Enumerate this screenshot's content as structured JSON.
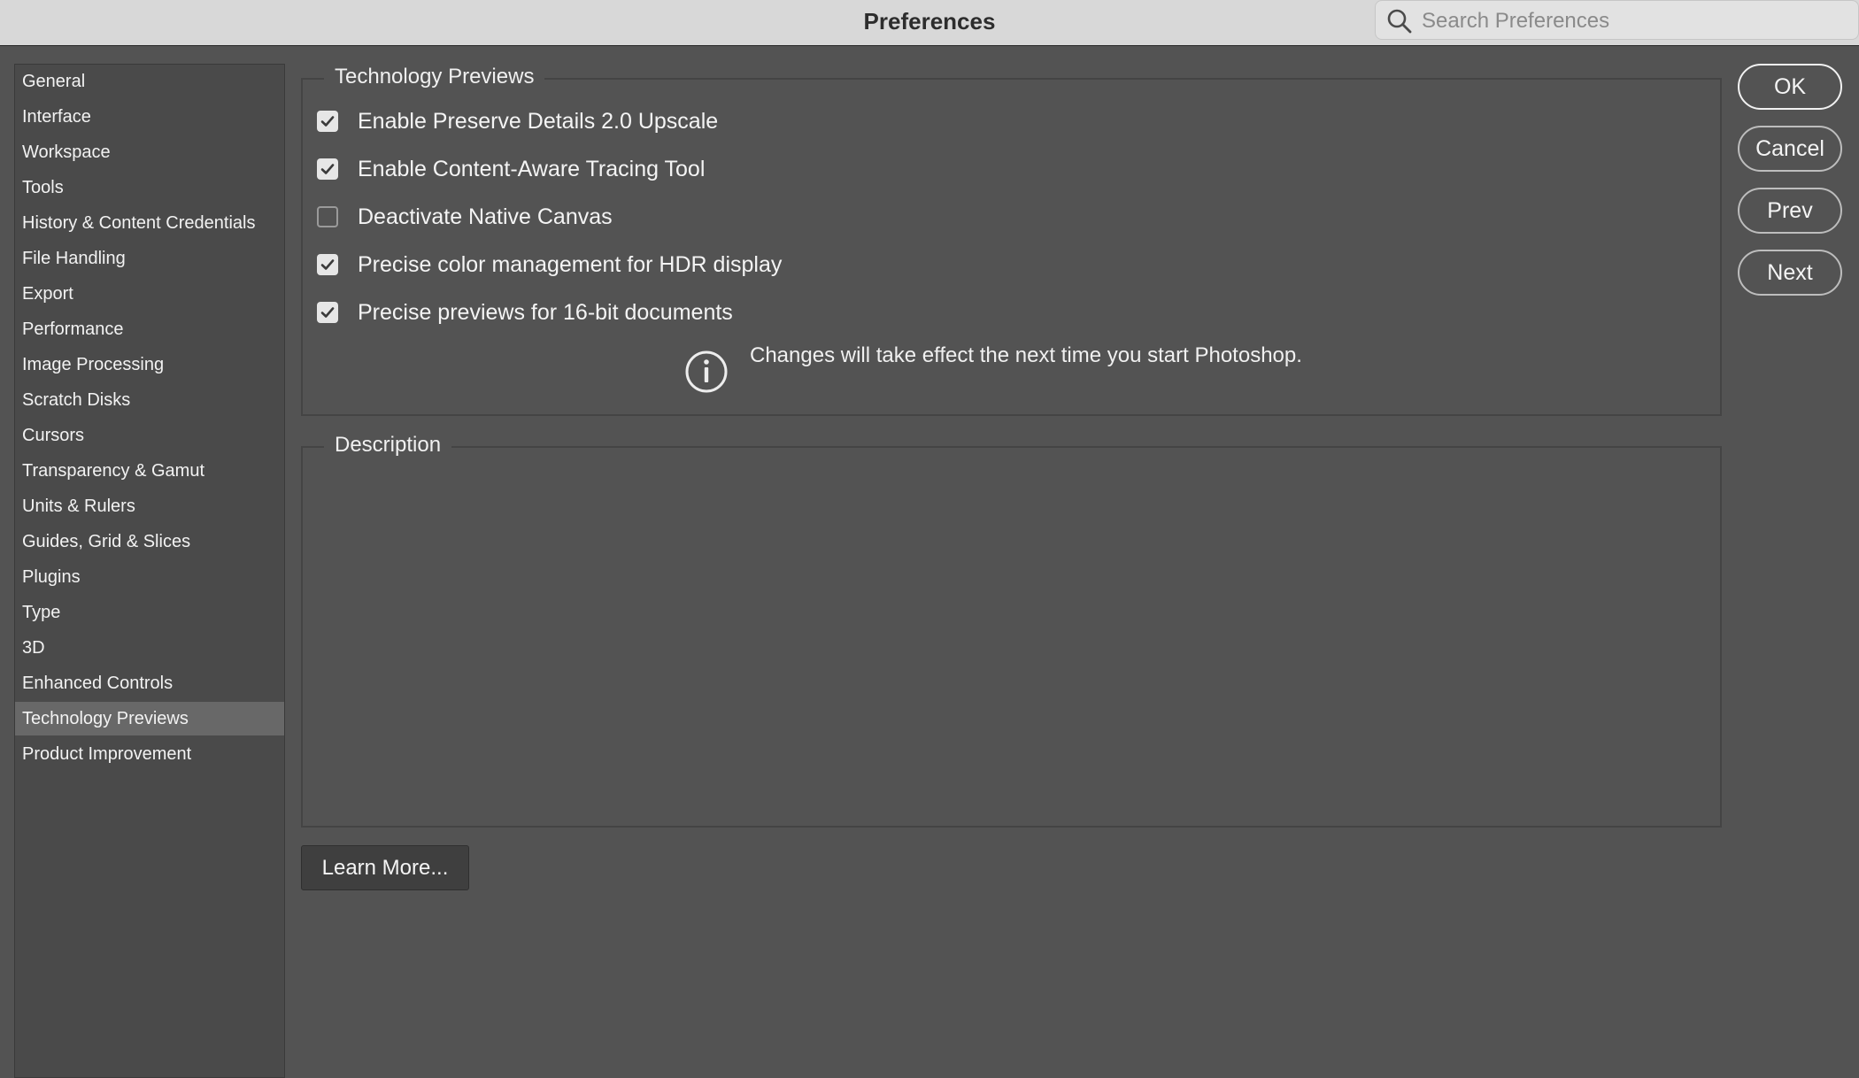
{
  "window": {
    "title": "Preferences"
  },
  "search": {
    "placeholder": "Search Preferences"
  },
  "sidebar": {
    "selected": "Technology Previews",
    "items": [
      {
        "label": "General"
      },
      {
        "label": "Interface"
      },
      {
        "label": "Workspace"
      },
      {
        "label": "Tools"
      },
      {
        "label": "History & Content Credentials"
      },
      {
        "label": "File Handling"
      },
      {
        "label": "Export"
      },
      {
        "label": "Performance"
      },
      {
        "label": "Image Processing"
      },
      {
        "label": "Scratch Disks"
      },
      {
        "label": "Cursors"
      },
      {
        "label": "Transparency & Gamut"
      },
      {
        "label": "Units & Rulers"
      },
      {
        "label": "Guides, Grid & Slices"
      },
      {
        "label": "Plugins"
      },
      {
        "label": "Type"
      },
      {
        "label": "3D"
      },
      {
        "label": "Enhanced Controls"
      },
      {
        "label": "Technology Previews"
      },
      {
        "label": "Product Improvement"
      }
    ]
  },
  "tech_previews": {
    "legend": "Technology Previews",
    "options": [
      {
        "label": "Enable Preserve Details 2.0 Upscale",
        "checked": true
      },
      {
        "label": "Enable Content-Aware Tracing Tool",
        "checked": true
      },
      {
        "label": "Deactivate Native Canvas",
        "checked": false
      },
      {
        "label": "Precise color management for HDR display",
        "checked": true
      },
      {
        "label": "Precise previews for 16-bit documents",
        "checked": true
      }
    ],
    "notice": "Changes will take effect the next time you start Photoshop."
  },
  "description": {
    "legend": "Description",
    "text": ""
  },
  "buttons": {
    "ok": "OK",
    "cancel": "Cancel",
    "prev": "Prev",
    "next": "Next",
    "learn_more": "Learn More..."
  },
  "colors": {
    "background": "#535353",
    "sidebar": "#4a4a4a",
    "selected_item": "#686868",
    "titlebar": "#d8d8d8"
  }
}
